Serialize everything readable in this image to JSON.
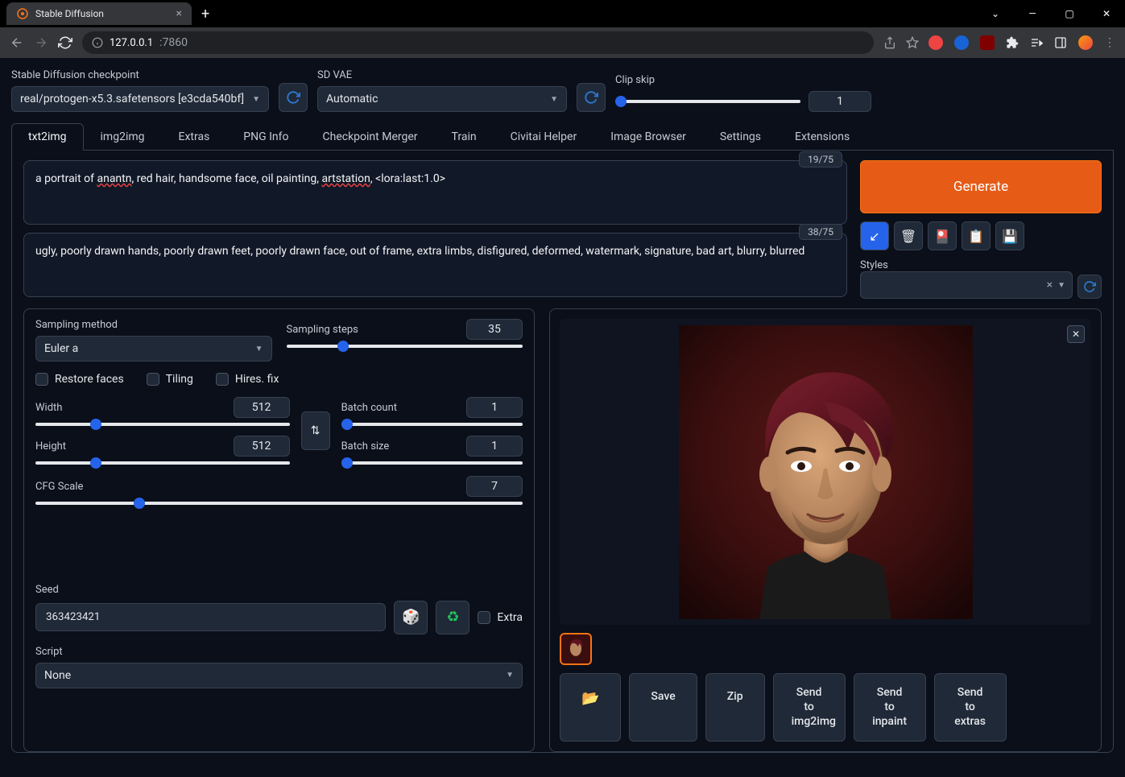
{
  "browser": {
    "tab_title": "Stable Diffusion",
    "url_host": "127.0.0.1",
    "url_port": ":7860"
  },
  "top": {
    "checkpoint_label": "Stable Diffusion checkpoint",
    "checkpoint_value": "real/protogen-x5.3.safetensors [e3cda540bf]",
    "vae_label": "SD VAE",
    "vae_value": "Automatic",
    "clip_label": "Clip skip",
    "clip_value": "1"
  },
  "tabs": [
    "txt2img",
    "img2img",
    "Extras",
    "PNG Info",
    "Checkpoint Merger",
    "Train",
    "Civitai Helper",
    "Image Browser",
    "Settings",
    "Extensions"
  ],
  "active_tab": "txt2img",
  "prompt": {
    "prefix": "a portrait of ",
    "w1": "anantn",
    "mid1": ", red hair, handsome face, oil painting, ",
    "w2": "artstation",
    "suffix": ", <lora:last:1.0>",
    "tokens": "19/75"
  },
  "neg_prompt": {
    "text": "ugly, poorly drawn hands, poorly drawn feet, poorly drawn face, out of frame, extra limbs, disfigured, deformed, watermark, signature, bad art, blurry, blurred",
    "tokens": "38/75"
  },
  "generate": "Generate",
  "styles_label": "Styles",
  "params": {
    "sampling_method_label": "Sampling method",
    "sampling_method": "Euler a",
    "sampling_steps_label": "Sampling steps",
    "sampling_steps": "35",
    "restore_faces": "Restore faces",
    "tiling": "Tiling",
    "hires_fix": "Hires. fix",
    "width_label": "Width",
    "width": "512",
    "height_label": "Height",
    "height": "512",
    "batch_count_label": "Batch count",
    "batch_count": "1",
    "batch_size_label": "Batch size",
    "batch_size": "1",
    "cfg_label": "CFG Scale",
    "cfg": "7",
    "seed_label": "Seed",
    "seed": "363423421",
    "extra": "Extra",
    "script_label": "Script",
    "script": "None"
  },
  "out_btns": {
    "save": "Save",
    "zip": "Zip",
    "img2img": "Send to img2img",
    "inpaint": "Send to inpaint",
    "extras": "Send to extras"
  }
}
